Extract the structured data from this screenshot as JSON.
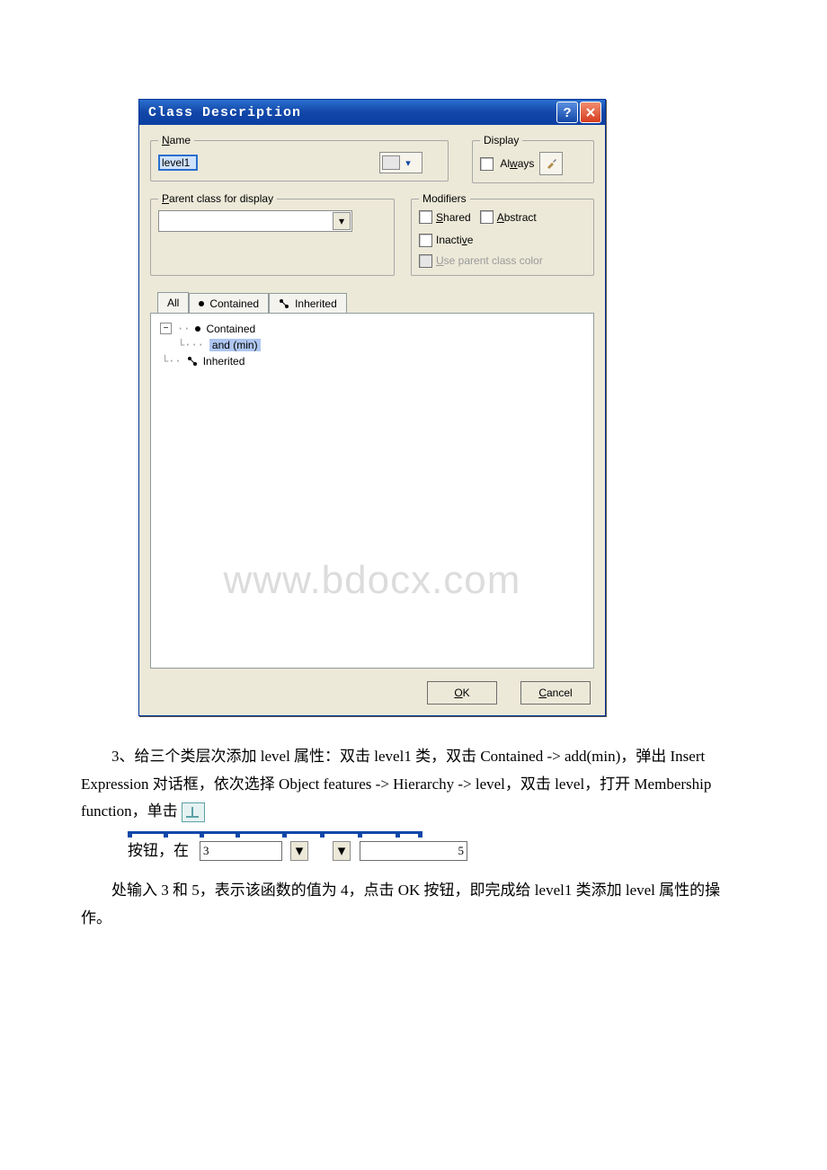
{
  "dialog": {
    "title": "Class Description",
    "name_group": {
      "legend_prefix": "N",
      "legend_rest": "ame",
      "value": "level1"
    },
    "display_group": {
      "legend": "Display",
      "always_prefix": "Al",
      "always_u": "w",
      "always_rest": "ays"
    },
    "parent_group": {
      "legend_prefix": "P",
      "legend_rest": "arent class for display"
    },
    "modifiers_group": {
      "legend": "Modifiers",
      "shared_u": "S",
      "shared_rest": "hared",
      "abstract_u": "A",
      "abstract_rest": "bstract",
      "inactive_pre": "Inacti",
      "inactive_u": "v",
      "inactive_post": "e",
      "useparent_u": "U",
      "useparent_rest": "se parent class color"
    },
    "tabs": {
      "all": "All",
      "contained": "Contained",
      "inherited": "Inherited"
    },
    "tree": {
      "node_contained": "Contained",
      "node_andmin": "and (min)",
      "node_inherited": "Inherited"
    },
    "buttons": {
      "ok_u": "O",
      "ok_rest": "K",
      "cancel_u": "C",
      "cancel_rest": "ancel"
    },
    "watermark": "www.bdocx.com"
  },
  "doc": {
    "p1": "3、给三个类层次添加 level 属性：双击 level1 类，双击 Contained -> add(min)，弹出 Insert Expression 对话框，依次选择 Object features -> Hierarchy -> level，双击 level，打开 Membership function，单击",
    "p2a": "按钮，在",
    "func_left": "3",
    "func_right": "5",
    "p3": "处输入 3 和 5，表示该函数的值为 4，点击 OK 按钮，即完成给 level1 类添加 level 属性的操作。"
  }
}
